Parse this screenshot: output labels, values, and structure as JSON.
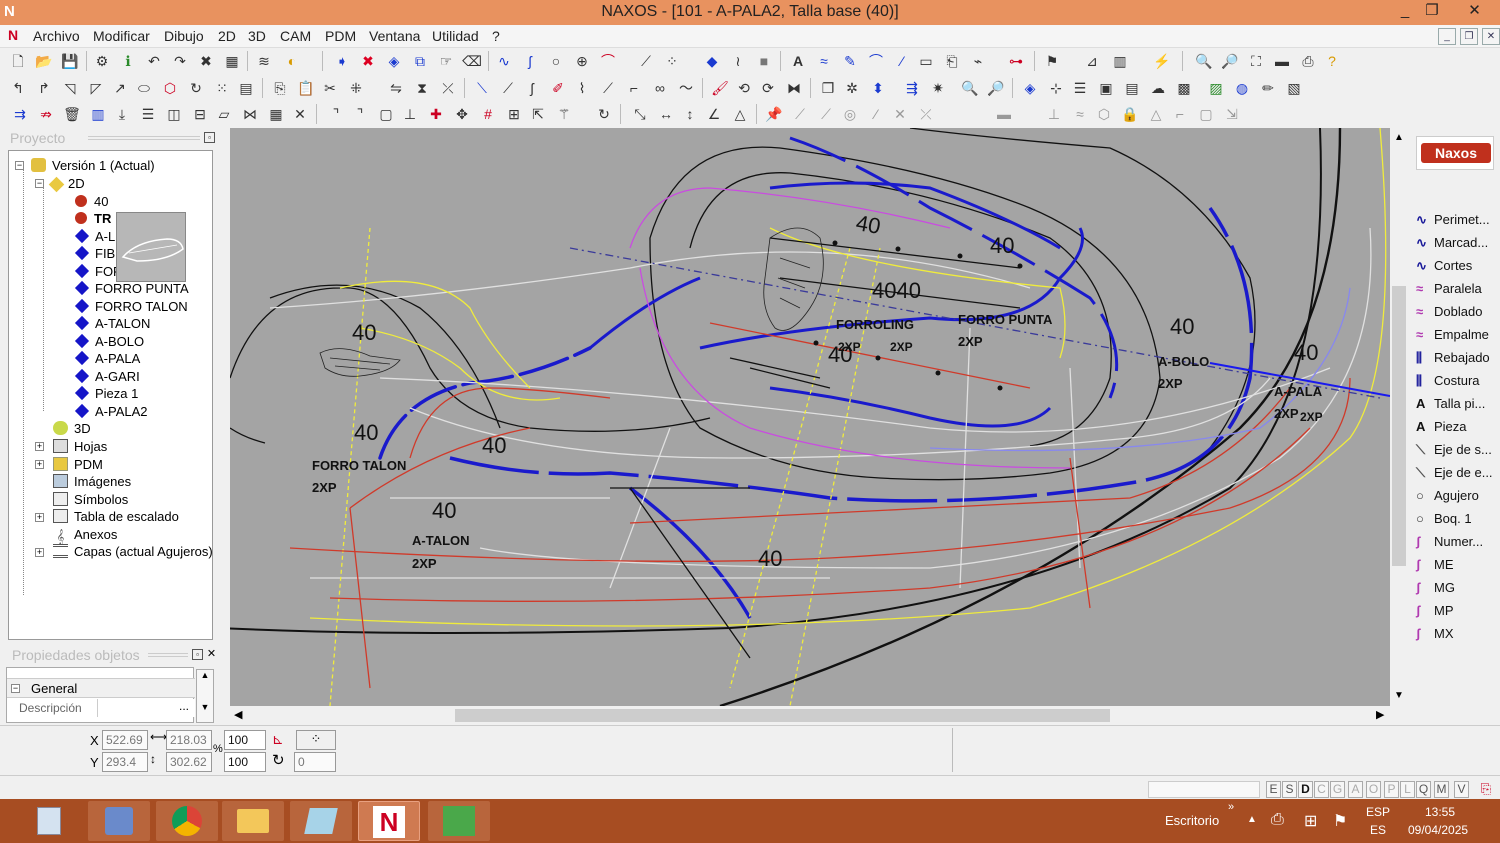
{
  "window": {
    "title": "NAXOS - [101 - A-PALA2, Talla base (40)]",
    "logo": "N",
    "controls": [
      "_",
      "❐",
      "✕"
    ]
  },
  "menu": [
    "Archivo",
    "Modificar",
    "Dibujo",
    "2D",
    "3D",
    "CAM",
    "PDM",
    "Ventana",
    "Utilidad",
    "?"
  ],
  "project": {
    "header": "Proyecto",
    "tree": [
      {
        "label": "Versión 1 (Actual)",
        "icon": "version-icon"
      },
      {
        "label": "2D",
        "icon": "2d-folder-icon"
      },
      {
        "label": "40",
        "icon": "red-dot-icon"
      },
      {
        "label": "TR",
        "icon": "red-dot-icon",
        "bold": true
      },
      {
        "label": "A-LI",
        "icon": "blue-diamond-icon"
      },
      {
        "label": "FIBI",
        "icon": "blue-diamond-icon"
      },
      {
        "label": "FOF",
        "icon": "blue-diamond-icon"
      },
      {
        "label": "FORRO PUNTA",
        "icon": "blue-diamond-icon"
      },
      {
        "label": "FORRO TALON",
        "icon": "blue-diamond-icon"
      },
      {
        "label": "A-TALON",
        "icon": "blue-diamond-icon"
      },
      {
        "label": "A-BOLO",
        "icon": "blue-diamond-icon"
      },
      {
        "label": "A-PALA",
        "icon": "blue-diamond-icon"
      },
      {
        "label": "A-GARI",
        "icon": "blue-diamond-icon"
      },
      {
        "label": "Pieza 1",
        "icon": "blue-diamond-icon"
      },
      {
        "label": "A-PALA2",
        "icon": "blue-diamond-icon"
      },
      {
        "label": "3D",
        "icon": "3d-icon"
      },
      {
        "label": "Hojas",
        "icon": "sheets-icon"
      },
      {
        "label": "PDM",
        "icon": "pdm-icon"
      },
      {
        "label": "Imágenes",
        "icon": "images-icon"
      },
      {
        "label": "Símbolos",
        "icon": "symbols-icon"
      },
      {
        "label": "Tabla de escalado",
        "icon": "scale-table-icon"
      },
      {
        "label": "Anexos",
        "icon": "attachments-icon"
      },
      {
        "label": "Capas (actual Agujeros)",
        "icon": "layers-icon"
      }
    ]
  },
  "properties": {
    "header": "Propiedades objetos",
    "group": "General",
    "row_label": "Descripción",
    "row_button": "..."
  },
  "canvas_labels": [
    {
      "text": "40"
    },
    {
      "text": "40"
    },
    {
      "text": "40"
    },
    {
      "text": "40"
    },
    {
      "text": "4040"
    },
    {
      "text": "40"
    },
    {
      "text": "40"
    },
    {
      "text": "40"
    },
    {
      "text": "40"
    },
    {
      "text": "40"
    },
    {
      "text": "40"
    },
    {
      "text": "FORRO TALON"
    },
    {
      "text": "2XP"
    },
    {
      "text": "A-TALON"
    },
    {
      "text": "2XP"
    },
    {
      "text": "FORRO PUNTA"
    },
    {
      "text": "2XP"
    },
    {
      "text": "FORROLING"
    },
    {
      "text": "A-BOLO"
    },
    {
      "text": "2XP"
    },
    {
      "text": "A-PALA"
    },
    {
      "text": "2XP"
    },
    {
      "text": "2XP"
    },
    {
      "text": "2XP"
    },
    {
      "text": "2XP"
    }
  ],
  "right_panel": {
    "brand": "Naxos",
    "items": [
      "Perimet...",
      "Marcad...",
      "Cortes",
      "Paralela",
      "Doblado",
      "Empalme",
      "Rebajado",
      "Costura",
      "Talla pi...",
      "Pieza",
      "Eje de s...",
      "Eje de e...",
      "Agujero",
      "Boq. 1",
      "Numer...",
      "ME",
      "MG",
      "MP",
      "MX"
    ]
  },
  "coords": {
    "x_label": "X",
    "x": "522.69",
    "y_label": "Y",
    "y": "293.4",
    "w": "218.03",
    "h": "302.62",
    "sx": "100",
    "sy": "100",
    "pct": "%",
    "rot": "0"
  },
  "status_letters": [
    "E",
    "S",
    "D",
    "C",
    "G",
    "A",
    "O",
    "P",
    "L",
    "Q",
    "M",
    "V"
  ],
  "taskbar": {
    "desk": "Escritorio",
    "lang1": "ESP",
    "lang2": "ES",
    "time": "13:55",
    "date": "09/04/2025"
  }
}
